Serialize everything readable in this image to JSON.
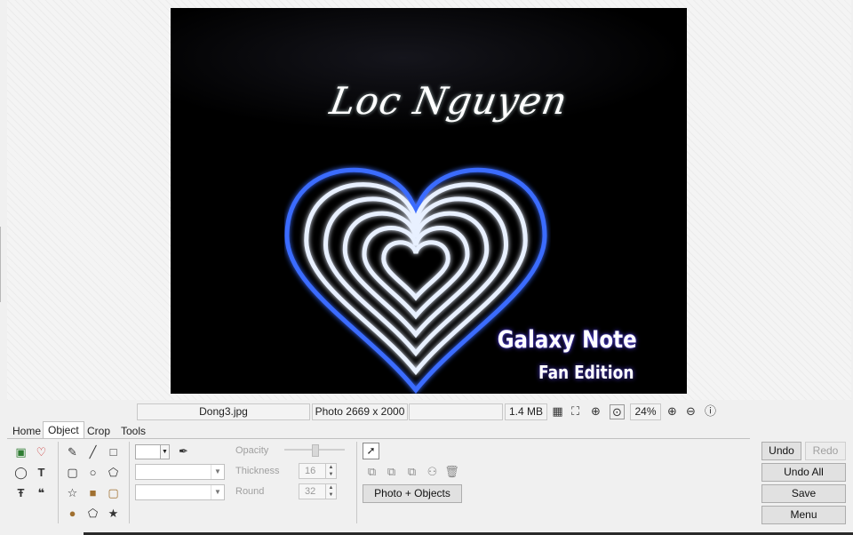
{
  "photo": {
    "title": "Loc Nguyen",
    "brand": "Galaxy Note",
    "subtitle": "Fan Edition",
    "heart_color": "#3b6cff"
  },
  "statusbar": {
    "filename": "Dong3.jpg",
    "dimensions": "Photo 2669 x 2000",
    "empty": "",
    "filesize": "1.4 MB",
    "zoom": "24%"
  },
  "tabs": [
    {
      "label": "Home"
    },
    {
      "label": "Object"
    },
    {
      "label": "Crop"
    },
    {
      "label": "Tools"
    }
  ],
  "active_tab": "Object",
  "properties": {
    "opacity_label": "Opacity",
    "thickness_label": "Thickness",
    "thickness_value": "16",
    "round_label": "Round",
    "round_value": "32"
  },
  "object_panel": {
    "photo_objects_button": "Photo + Objects"
  },
  "actions": {
    "undo": "Undo",
    "redo": "Redo",
    "undo_all": "Undo All",
    "save": "Save",
    "menu": "Menu"
  }
}
